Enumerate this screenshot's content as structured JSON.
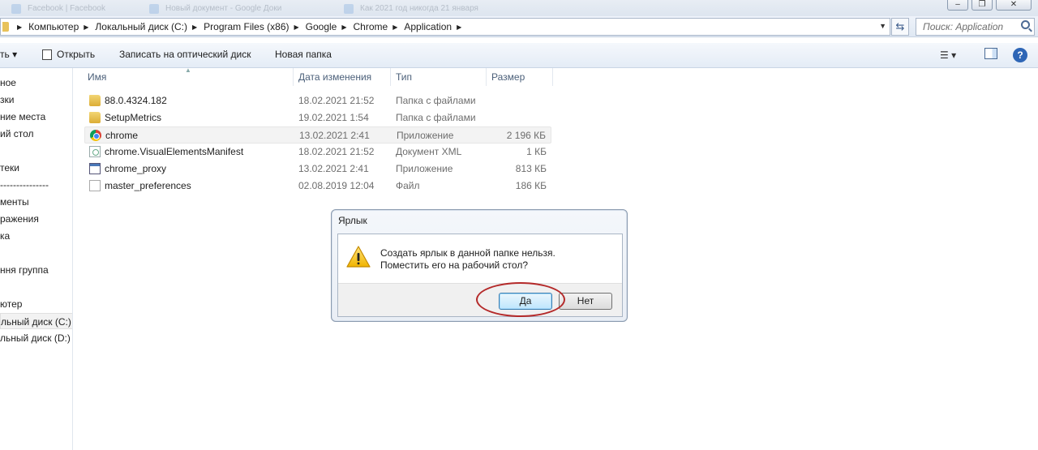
{
  "tabs": [
    {
      "label": "Facebook | Facebook"
    },
    {
      "label": "Новый документ - Google Доки"
    },
    {
      "label": "Как 2021 год никогда 21 января"
    }
  ],
  "window_buttons": {
    "minimize": "‒",
    "maximize": "❐",
    "close": "✕"
  },
  "address": {
    "crumbs": [
      "Компьютер",
      "Локальный диск (C:)",
      "Program Files (x86)",
      "Google",
      "Chrome",
      "Application"
    ],
    "search_placeholder": "Поиск: Application"
  },
  "toolbar": {
    "organize_label": "ть ▾",
    "open_label": "Открыть",
    "burn_label": "Записать на оптический диск",
    "new_folder_label": "Новая папка",
    "help_label": "?"
  },
  "sidebar": {
    "items": [
      {
        "label": "ное"
      },
      {
        "label": "зки"
      },
      {
        "label": "ние места"
      },
      {
        "label": "ий стол"
      },
      {
        "label": "теки"
      },
      {
        "label": "---------------"
      },
      {
        "label": "менты"
      },
      {
        "label": "ражения"
      },
      {
        "label": "ка"
      },
      {
        "label": "ння группа"
      },
      {
        "label": "ютер"
      },
      {
        "label": "льный диск (C:)"
      },
      {
        "label": "льный диск (D:)"
      }
    ]
  },
  "columns": {
    "name": "Имя",
    "date": "Дата изменения",
    "type": "Тип",
    "size": "Размер"
  },
  "files": [
    {
      "name": "88.0.4324.182",
      "date": "18.02.2021 21:52",
      "type": "Папка с файлами",
      "size": "",
      "icon": "folder-icon"
    },
    {
      "name": "SetupMetrics",
      "date": "19.02.2021 1:54",
      "type": "Папка с файлами",
      "size": "",
      "icon": "folder-icon"
    },
    {
      "name": "chrome",
      "date": "13.02.2021 2:41",
      "type": "Приложение",
      "size": "2 196 КБ",
      "icon": "chrome-icon"
    },
    {
      "name": "chrome.VisualElementsManifest",
      "date": "18.02.2021 21:52",
      "type": "Документ XML",
      "size": "1 КБ",
      "icon": "xml-file-icon"
    },
    {
      "name": "chrome_proxy",
      "date": "13.02.2021 2:41",
      "type": "Приложение",
      "size": "813 КБ",
      "icon": "app-icon"
    },
    {
      "name": "master_preferences",
      "date": "02.08.2019 12:04",
      "type": "Файл",
      "size": "186 КБ",
      "icon": "file-icon"
    }
  ],
  "dialog": {
    "title": "Ярлык",
    "message": "Создать ярлык в данной папке нельзя.\nПоместить его на рабочий стол?",
    "yes_label": "Да",
    "no_label": "Нет",
    "highlight_color": "#b42a2a"
  }
}
